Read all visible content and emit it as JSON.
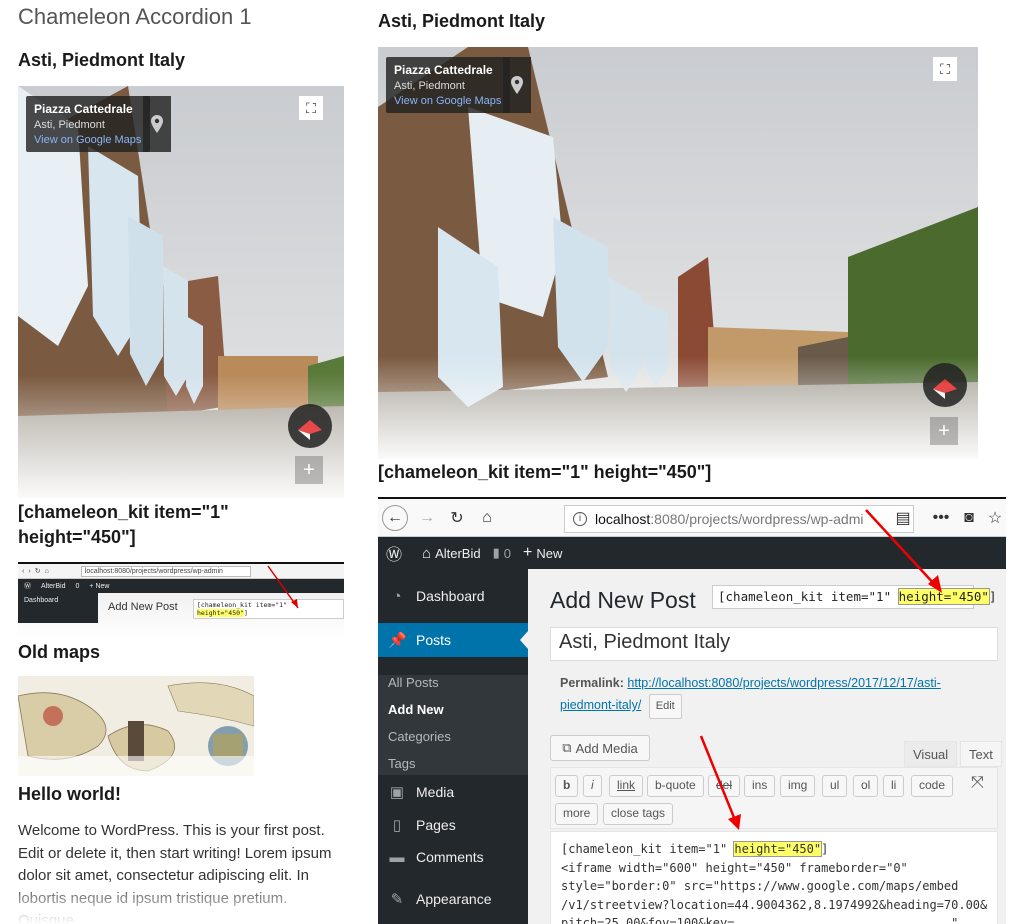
{
  "left": {
    "accordion_title": "Chameleon Accordion 1",
    "heading": "Asti, Piedmont Italy",
    "shortcode": "[chameleon_kit item=\"1\" height=\"450\"]",
    "old_maps": "Old maps",
    "hello": "Hello world!",
    "welcome": "Welcome to WordPress. This is your first post. Edit or delete it, then start writing! Lorem ipsum dolor sit amet, consectetur adipiscing elit. In lobortis neque id ipsum tristique pretium. Quisque"
  },
  "streetview": {
    "place": "Piazza Cattedrale",
    "address": "Asti, Piedmont",
    "link": "View on Google Maps"
  },
  "mini": {
    "url": "localhost:8080/projects/wordpress/wp-admin",
    "site": "AlterBid",
    "comments": "0",
    "new": "+ New",
    "dashboard": "Dashboard",
    "title": "Add New Post",
    "code_prefix": "[chameleon_kit item=\"1\" ",
    "code_hl": "height=\"450\"",
    "code_suffix": "]"
  },
  "right": {
    "heading": "Asti, Piedmont Italy",
    "shortcode": "[chameleon_kit item=\"1\" height=\"450\"]"
  },
  "browser": {
    "url_host": "localhost",
    "url_path": ":8080/projects/wordpress/wp-admi"
  },
  "wp": {
    "site": "AlterBid",
    "comments": "0",
    "new": "New",
    "sidebar": {
      "dashboard": "Dashboard",
      "posts": "Posts",
      "all_posts": "All Posts",
      "add_new": "Add New",
      "categories": "Categories",
      "tags": "Tags",
      "media": "Media",
      "pages": "Pages",
      "comments": "Comments",
      "appearance": "Appearance"
    },
    "page_title": "Add New Post",
    "sc_prefix": "[chameleon_kit item=\"1\" ",
    "sc_hl": "height=\"450\"",
    "sc_suffix": "]",
    "post_title": "Asti, Piedmont Italy",
    "permalink_label": "Permalink:",
    "permalink_url": "http://localhost:8080/projects/wordpress/2017/12/17/asti-piedmont-italy/",
    "edit": "Edit",
    "add_media": "Add Media",
    "tab_visual": "Visual",
    "tab_text": "Text",
    "quicktags": [
      "b",
      "i",
      "link",
      "b-quote",
      "del",
      "ins",
      "img",
      "ul",
      "ol",
      "li",
      "code",
      "more",
      "close tags"
    ],
    "editor_line1_prefix": "[chameleon_kit item=\"1\" ",
    "editor_line1_hl": "height=\"450\"",
    "editor_line1_suffix": "]",
    "editor_rest": "<iframe width=\"600\" height=\"450\" frameborder=\"0\"\nstyle=\"border:0\" src=\"https://www.google.com/maps/embed\n/v1/streetview?location=44.9004362,8.1974992&heading=70.00&\npitch=25.00&fov=100&key=                              \""
  }
}
